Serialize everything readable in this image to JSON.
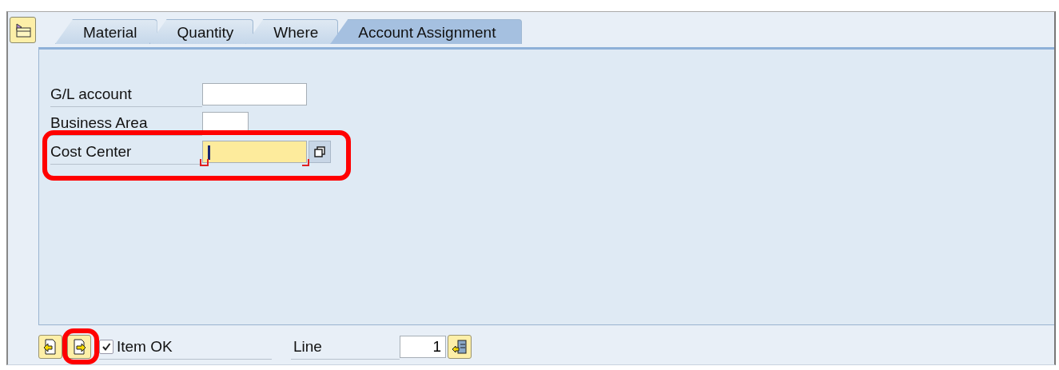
{
  "tabs": [
    {
      "label": "Material",
      "selected": false
    },
    {
      "label": "Quantity",
      "selected": false
    },
    {
      "label": "Where",
      "selected": false
    },
    {
      "label": "Account Assignment",
      "selected": true
    }
  ],
  "fields": [
    {
      "label": "G/L account",
      "focused": false,
      "required": false,
      "search_help": false,
      "highlighted": false
    },
    {
      "label": "Business Area",
      "focused": false,
      "required": false,
      "search_help": false,
      "highlighted": false
    },
    {
      "label": "Cost Center",
      "focused": true,
      "required": true,
      "search_help": true,
      "highlighted": true
    }
  ],
  "footer": {
    "nav_buttons": [
      {
        "kind": "previous",
        "highlighted": false
      },
      {
        "kind": "next",
        "highlighted": true
      }
    ],
    "item_ok": {
      "label": "Item OK",
      "checked": true
    },
    "line": {
      "label": "Line",
      "value": "1"
    }
  }
}
